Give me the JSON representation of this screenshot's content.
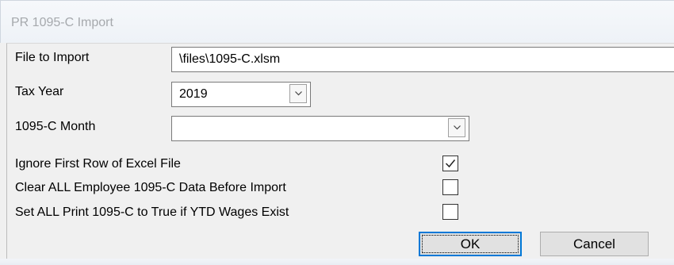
{
  "window": {
    "title": "PR 1095-C Import"
  },
  "form": {
    "file_to_import": {
      "label": "File to Import",
      "value": "\\files\\1095-C.xlsm"
    },
    "tax_year": {
      "label": "Tax Year",
      "value": "2019"
    },
    "month": {
      "label": "1095-C Month",
      "value": ""
    },
    "ignore_first_row": {
      "label": "Ignore First Row of Excel File",
      "checked": true
    },
    "clear_all_data": {
      "label": "Clear ALL Employee 1095-C Data Before Import",
      "checked": false
    },
    "set_all_print": {
      "label": "Set ALL Print 1095-C to True if YTD Wages Exist",
      "checked": false
    }
  },
  "buttons": {
    "ok_label": "OK",
    "cancel_label": "Cancel"
  },
  "colors": {
    "focus_border": "#0078d7",
    "title_text": "#a6a9ad",
    "window_bg": "#f0f0f0"
  }
}
